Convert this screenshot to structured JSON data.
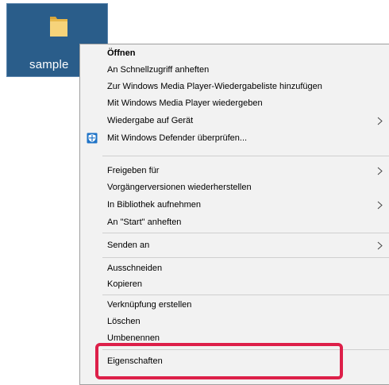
{
  "desktop_icon": {
    "label": "sample",
    "icon": "folder-icon"
  },
  "context_menu": {
    "items": [
      {
        "label": "Öffnen",
        "bold": true
      },
      {
        "label": "An Schnellzugriff anheften"
      },
      {
        "label": "Zur Windows Media Player-Wiedergabeliste hinzufügen"
      },
      {
        "label": "Mit Windows Media Player wiedergeben"
      },
      {
        "label": "Wiedergabe auf Gerät",
        "submenu": true
      },
      {
        "label": "Mit Windows Defender überprüfen...",
        "icon": "windows-defender-shield-icon"
      },
      {
        "label": "Freigeben für",
        "submenu": true
      },
      {
        "label": "Vorgängerversionen wiederherstellen"
      },
      {
        "label": "In Bibliothek aufnehmen",
        "submenu": true
      },
      {
        "label": "An \"Start\" anheften"
      },
      {
        "label": "Senden an",
        "submenu": true
      },
      {
        "label": "Ausschneiden"
      },
      {
        "label": "Kopieren"
      },
      {
        "label": "Verknüpfung erstellen"
      },
      {
        "label": "Löschen"
      },
      {
        "label": "Umbenennen"
      },
      {
        "label": "Eigenschaften"
      }
    ]
  },
  "colors": {
    "selection": "#2a5d8a",
    "menu_background": "#f2f2f2",
    "highlight_border": "#dd1f49",
    "defender_icon": "#1e73c7"
  }
}
